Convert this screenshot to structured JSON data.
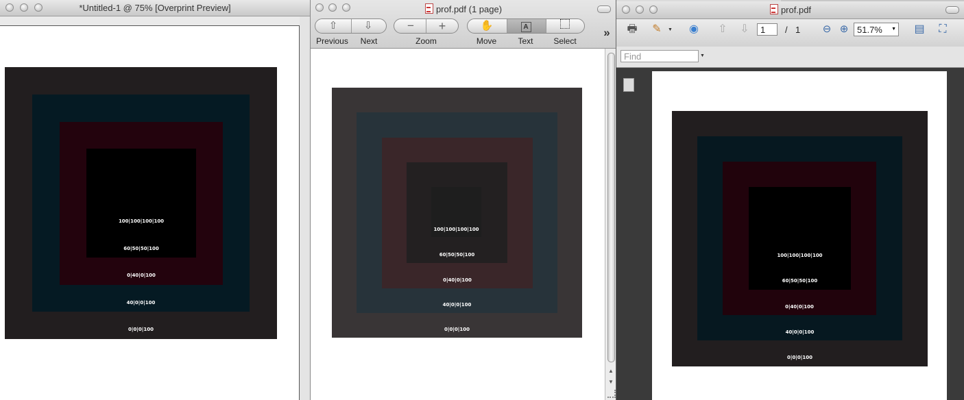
{
  "win1": {
    "title": "*Untitled-1 @ 75% [Overprint Preview]"
  },
  "win2": {
    "title": "prof.pdf (1 page)",
    "toolbar": {
      "previous": "Previous",
      "next": "Next",
      "zoom": "Zoom",
      "move": "Move",
      "text": "Text",
      "select": "Select",
      "overflow": "»",
      "zoom_out": "−",
      "zoom_in": "+"
    }
  },
  "win3": {
    "title": "prof.pdf",
    "page_current": "1",
    "page_sep": "/",
    "page_total": "1",
    "zoom": "51.7%",
    "find_placeholder": "Find"
  },
  "swatches": [
    "100|100|100|100",
    "60|50|50|100",
    "0|40|0|100",
    "40|0|0|100",
    "0|0|0|100"
  ],
  "colors": {
    "win1": [
      "#221e1f",
      "#051a23",
      "#23030d",
      "#000000"
    ],
    "win2": [
      "#393536",
      "#27333a",
      "#3a2629",
      "#232021",
      "#1e1e1e"
    ],
    "win3": [
      "#221e1f",
      "#061820",
      "#21030c",
      "#000000"
    ]
  }
}
